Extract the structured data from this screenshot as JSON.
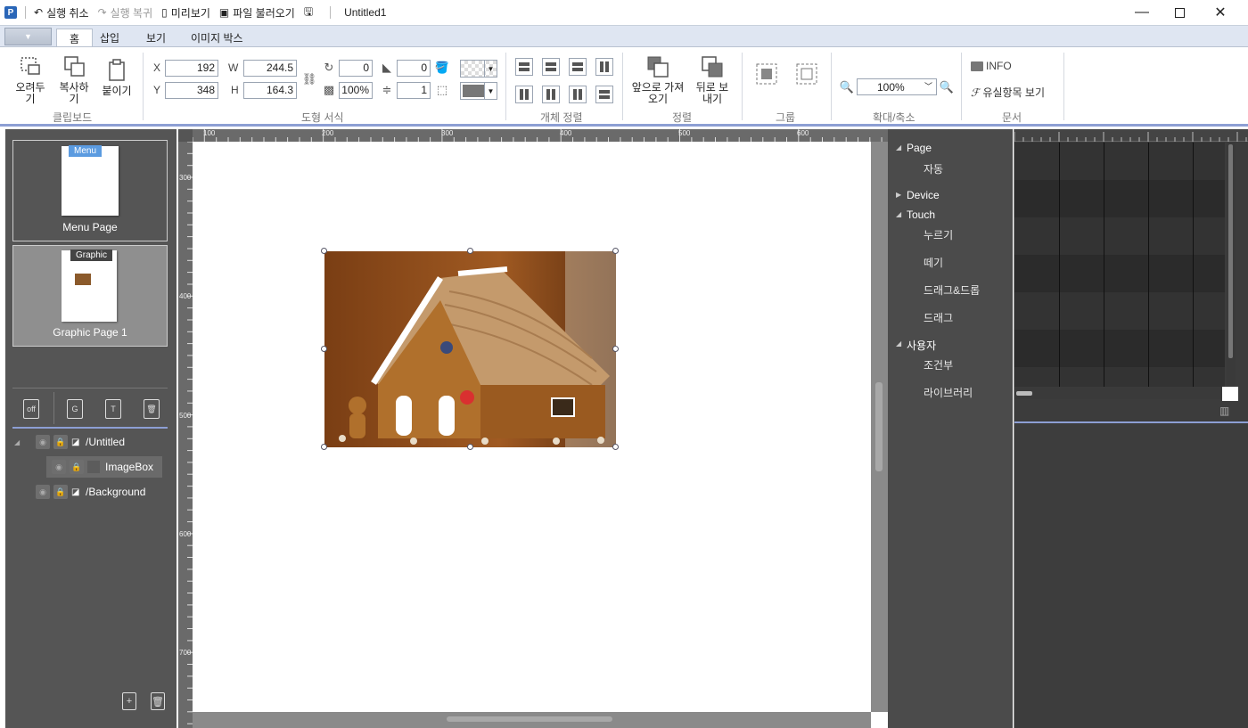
{
  "titlebar": {
    "app_icon": "P",
    "undo": "실행 취소",
    "redo": "실행 복귀",
    "preview": "미리보기",
    "open_file": "파일 불러오기",
    "document_title": "Untitled1"
  },
  "tabs": [
    "홈",
    "삽입",
    "보기",
    "이미지 박스"
  ],
  "ribbon": {
    "clipboard": {
      "cut": "오려두기",
      "copy": "복사하기",
      "paste": "붙이기",
      "label": "클립보드"
    },
    "shape_format": {
      "x_label": "X",
      "x_value": "192",
      "y_label": "Y",
      "y_value": "348",
      "w_label": "W",
      "w_value": "244.5",
      "h_label": "H",
      "h_value": "164.3",
      "rotation": "0",
      "opacity": "100%",
      "corner": "0",
      "line_width": "1",
      "label": "도형 서식"
    },
    "object_align": {
      "label": "개체 정렬"
    },
    "arrange": {
      "bring_front": "앞으로 가져오기",
      "send_back": "뒤로 보내기",
      "label": "정렬"
    },
    "group": {
      "label": "그룹"
    },
    "zoom": {
      "value": "100%",
      "label": "확대/축소"
    },
    "document": {
      "info": "INFO",
      "valid_items": "유실항목 보기",
      "label": "문서"
    }
  },
  "pages": [
    {
      "tag": "Menu",
      "label": "Menu Page"
    },
    {
      "tag": "Graphic",
      "label": "Graphic Page 1"
    }
  ],
  "layers": [
    {
      "name": "/Untitled"
    },
    {
      "name": "ImageBox"
    },
    {
      "name": "/Background"
    }
  ],
  "ruler": {
    "h": [
      "100",
      "200",
      "300",
      "400",
      "500",
      "600"
    ],
    "v": [
      "300",
      "400",
      "500",
      "600",
      "700"
    ]
  },
  "events": {
    "page": "Page",
    "auto": "자동",
    "device": "Device",
    "touch": "Touch",
    "press": "누르기",
    "release": "떼기",
    "drag_drop": "드래그&드롭",
    "drag": "드래그",
    "user": "사용자",
    "condition": "조건부",
    "library": "라이브러리"
  },
  "colors": {
    "accent": "#8d9fd4",
    "panel_bg": "#555555",
    "menu_tag": "#5b9be0"
  }
}
